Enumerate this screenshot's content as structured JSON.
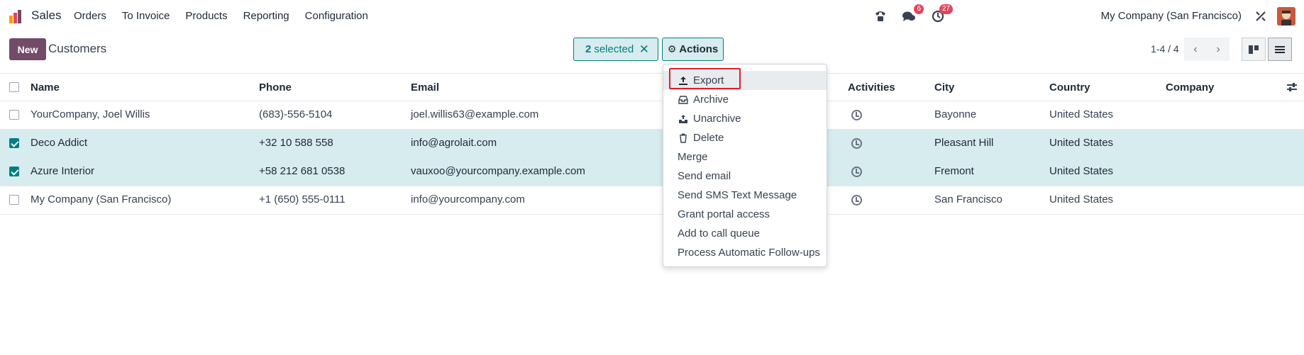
{
  "navbar": {
    "app_name": "Sales",
    "menu": [
      "Orders",
      "To Invoice",
      "Products",
      "Reporting",
      "Configuration"
    ],
    "messages_badge": "6",
    "activities_badge": "27",
    "company": "My Company (San Francisco)"
  },
  "control": {
    "new_label": "New",
    "title": "Customers",
    "selected_count": "2",
    "selected_label": "selected",
    "actions_label": "Actions",
    "pager": "1-4 / 4"
  },
  "table": {
    "headers": [
      "Name",
      "Phone",
      "Email",
      "Activities",
      "City",
      "Country",
      "Company"
    ],
    "rows": [
      {
        "name": "YourCompany, Joel Willis",
        "phone": "(683)-556-5104",
        "email": "joel.willis63@example.com",
        "city": "Bayonne",
        "country": "United States",
        "company": "",
        "selected": false
      },
      {
        "name": "Deco Addict",
        "phone": "+32 10 588 558",
        "email": "info@agrolait.com",
        "city": "Pleasant Hill",
        "country": "United States",
        "company": "",
        "selected": true
      },
      {
        "name": "Azure Interior",
        "phone": "+58 212 681 0538",
        "email": "vauxoo@yourcompany.example.com",
        "city": "Fremont",
        "country": "United States",
        "company": "",
        "selected": true
      },
      {
        "name": "My Company (San Francisco)",
        "phone": "+1 (650) 555-0111",
        "email": "info@yourcompany.com",
        "city": "San Francisco",
        "country": "United States",
        "company": "",
        "selected": false
      }
    ]
  },
  "actions_menu": {
    "items": [
      {
        "label": "Export",
        "icon": "upload-icon"
      },
      {
        "label": "Archive",
        "icon": "inbox-icon"
      },
      {
        "label": "Unarchive",
        "icon": "unarchive-icon"
      },
      {
        "label": "Delete",
        "icon": "trash-icon"
      },
      {
        "label": "Merge",
        "icon": ""
      },
      {
        "label": "Send email",
        "icon": ""
      },
      {
        "label": "Send SMS Text Message",
        "icon": ""
      },
      {
        "label": "Grant portal access",
        "icon": ""
      },
      {
        "label": "Add to call queue",
        "icon": ""
      },
      {
        "label": "Process Automatic Follow-ups",
        "icon": ""
      }
    ]
  },
  "colors": {
    "brand": "#714b67",
    "accent": "#017e84",
    "selected_row": "#d7ecef",
    "highlight": "#e11d2e",
    "badge": "#e3455a"
  }
}
